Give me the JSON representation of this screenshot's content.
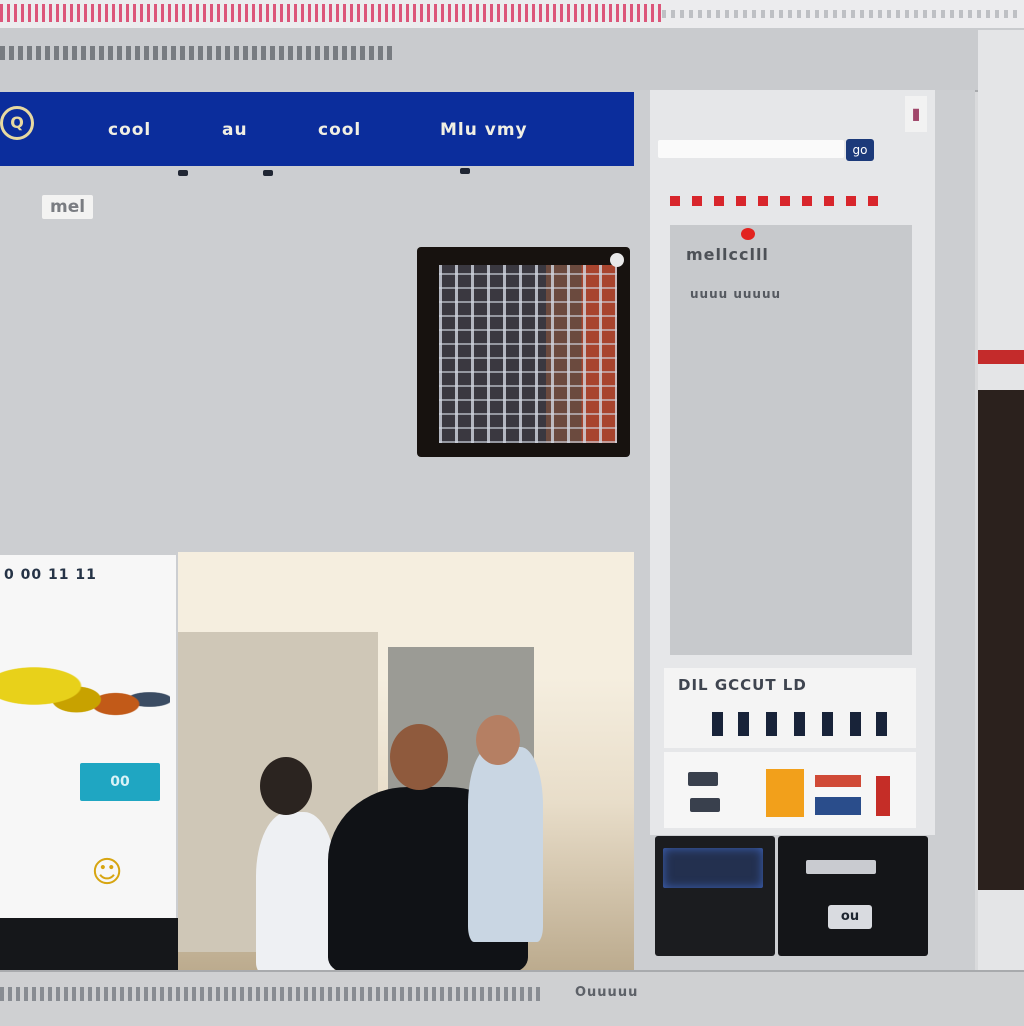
{
  "header": {
    "logo_text": "Q",
    "items": [
      "cool",
      "au",
      "cool",
      "Mlu vmy"
    ]
  },
  "section_label": "mel",
  "right_panel": {
    "panel_title": "mellcclll",
    "panel_subtitle": "uuuu uuuuu",
    "search_button": "go",
    "stats_label": "DIL GCCUT LD",
    "unit_dial": "ou"
  },
  "left_card": {
    "label": "0 00 11 11",
    "cyan_button": "00",
    "emoji": "☺"
  },
  "footer": {
    "status": "Ouuuuu"
  },
  "colors": {
    "header_blue": "#0b2d9c",
    "alert_red": "#d8262c",
    "accent_orange": "#f2a01b",
    "cyan": "#1fa6c2"
  },
  "icons": [
    "logo-circle-icon",
    "photo-corner-icon",
    "panel-corner-icon",
    "emoji-icon"
  ]
}
